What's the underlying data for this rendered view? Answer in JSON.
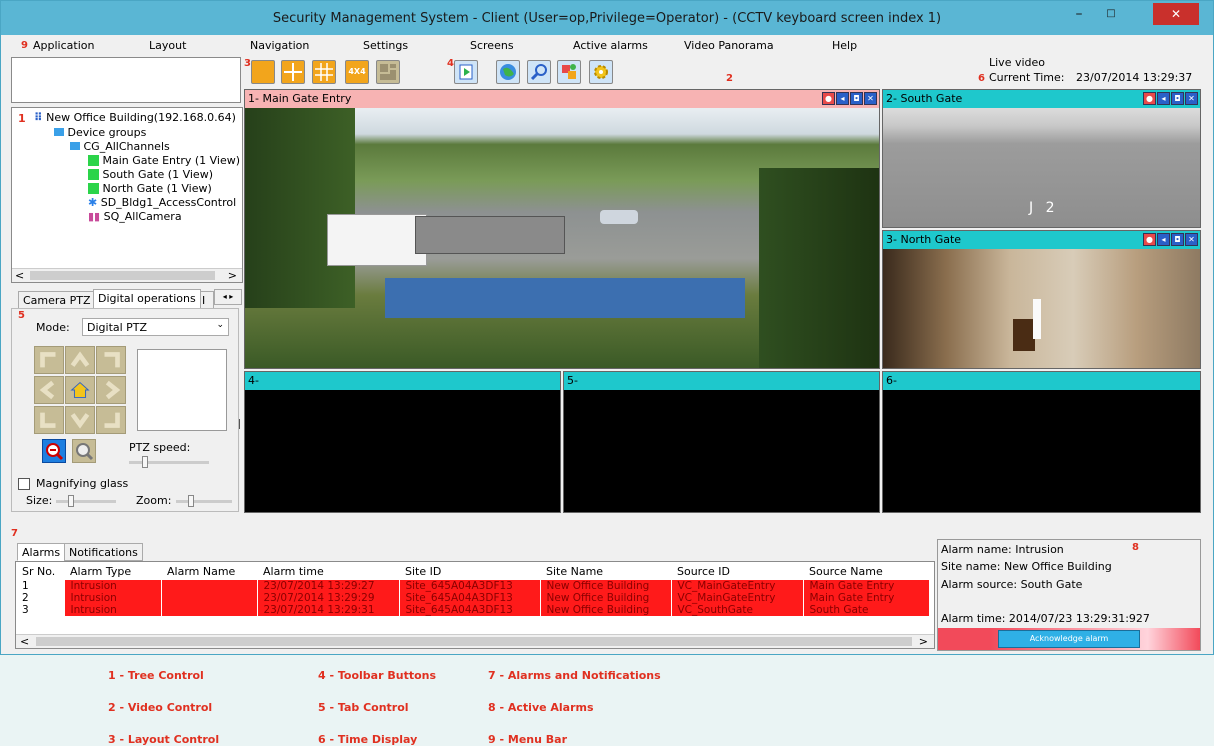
{
  "window": {
    "title": "Security Management System - Client (User=op,Privilege=Operator) - (CCTV keyboard screen index 1)",
    "min_glyph": "–",
    "max_glyph": "□",
    "close_glyph": "✕"
  },
  "annotations": {
    "n1": "1",
    "n2": "2",
    "n3": "3",
    "n4": "4",
    "n5": "5",
    "n6": "6",
    "n7": "7",
    "n8": "8",
    "n9": "9"
  },
  "menu": [
    "Application",
    "Layout",
    "Navigation",
    "Settings",
    "Screens",
    "Active alarms",
    "Video Panorama",
    "Help"
  ],
  "toolbar": {
    "layout_4x4_label": "4X4"
  },
  "time_display": {
    "mode": "Live video",
    "label": "Current Time:",
    "value": "23/07/2014 13:29:37"
  },
  "tree": {
    "root": "New Office Building(192.168.0.64)",
    "groups": "Device groups",
    "channel_group": "CG_AllChannels",
    "views": [
      "Main Gate Entry (1 View)",
      "South Gate (1 View)",
      "North Gate (1 View)"
    ],
    "access": "SD_Bldg1_AccessControl",
    "sequence": "SQ_AllCamera",
    "scroll_left": "<",
    "scroll_right": ">"
  },
  "tabs": {
    "items": [
      "Camera PTZ",
      "Digital operations",
      "I"
    ],
    "mode_label": "Mode:",
    "mode_value": "Digital PTZ",
    "ptz_speed_label": "PTZ speed:",
    "magnifying_label": "Magnifying glass",
    "size_label": "Size:",
    "zoom_label": "Zoom:"
  },
  "videos": {
    "v1": "1- Main Gate Entry",
    "v2": "2- South Gate",
    "v3": "3- North Gate",
    "v4": "4-",
    "v5": "5-",
    "v6": "6-",
    "south_overlay": "J 2"
  },
  "alarms": {
    "tabs": [
      "Alarms",
      "Notifications"
    ],
    "columns": [
      "Sr No.",
      "Alarm Type",
      "Alarm Name",
      "Alarm time",
      "Site ID",
      "Site Name",
      "Source ID",
      "Source Name"
    ],
    "rows": [
      [
        "1",
        "Intrusion",
        "",
        "23/07/2014 13:29:27",
        "Site_645A04A3DF13",
        "New Office Building",
        "VC_MainGateEntry",
        "Main Gate Entry"
      ],
      [
        "2",
        "Intrusion",
        "",
        "23/07/2014 13:29:29",
        "Site_645A04A3DF13",
        "New Office Building",
        "VC_MainGateEntry",
        "Main Gate Entry"
      ],
      [
        "3",
        "Intrusion",
        "",
        "23/07/2014 13:29:31",
        "Site_645A04A3DF13",
        "New Office Building",
        "VC_SouthGate",
        "South Gate"
      ]
    ],
    "scroll_left": "<",
    "scroll_right": ">"
  },
  "active_alarm": {
    "name": "Alarm name: Intrusion",
    "site": "Site name: New Office Building",
    "source": "Alarm source: South Gate",
    "time": "Alarm time: 2014/07/23 13:29:31:927",
    "ack": "Acknowledge alarm"
  },
  "legend": [
    "1 - Tree Control",
    "2 - Video Control",
    "3 - Layout Control",
    "4 - Toolbar Buttons",
    "5 - Tab Control",
    "6 - Time Display",
    "7 - Alarms and Notifications",
    "8 - Active Alarms",
    "9 - Menu Bar"
  ],
  "colors": {
    "titlebar": "#5ab6d4",
    "cyan_header": "#1ec8cc",
    "pink_header": "#f7b3b3",
    "alarm_red": "#ff1a1a"
  }
}
